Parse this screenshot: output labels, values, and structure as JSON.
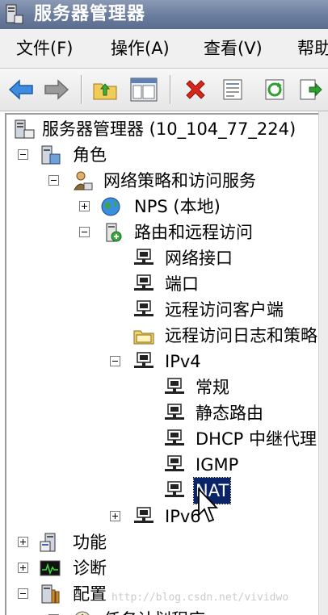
{
  "window": {
    "title": "服务器管理器"
  },
  "menu": {
    "file": "文件(F)",
    "action": "操作(A)",
    "view": "查看(V)",
    "help": "帮助"
  },
  "tree": {
    "root": "服务器管理器 (10_104_77_224)",
    "roles": "角色",
    "nps_services": "网络策略和访问服务",
    "nps_local": "NPS (本地)",
    "rras": "路由和远程访问",
    "network_interfaces": "网络接口",
    "ports": "端口",
    "remote_clients": "远程访问客户端",
    "remote_logging": "远程访问日志和策略",
    "ipv4": "IPv4",
    "general": "常规",
    "static_routes": "静态路由",
    "dhcp_relay": "DHCP 中继代理",
    "igmp": "IGMP",
    "nat": "NAT",
    "ipv6": "IPv6",
    "features": "功能",
    "diagnostics": "诊断",
    "configuration": "配置",
    "task_scheduler": "任务计划程序"
  },
  "watermark": "http://blog.csdn.net/vividwo",
  "colors": {
    "selection": "#0a246a",
    "title_bar": "#6d7f9f"
  }
}
